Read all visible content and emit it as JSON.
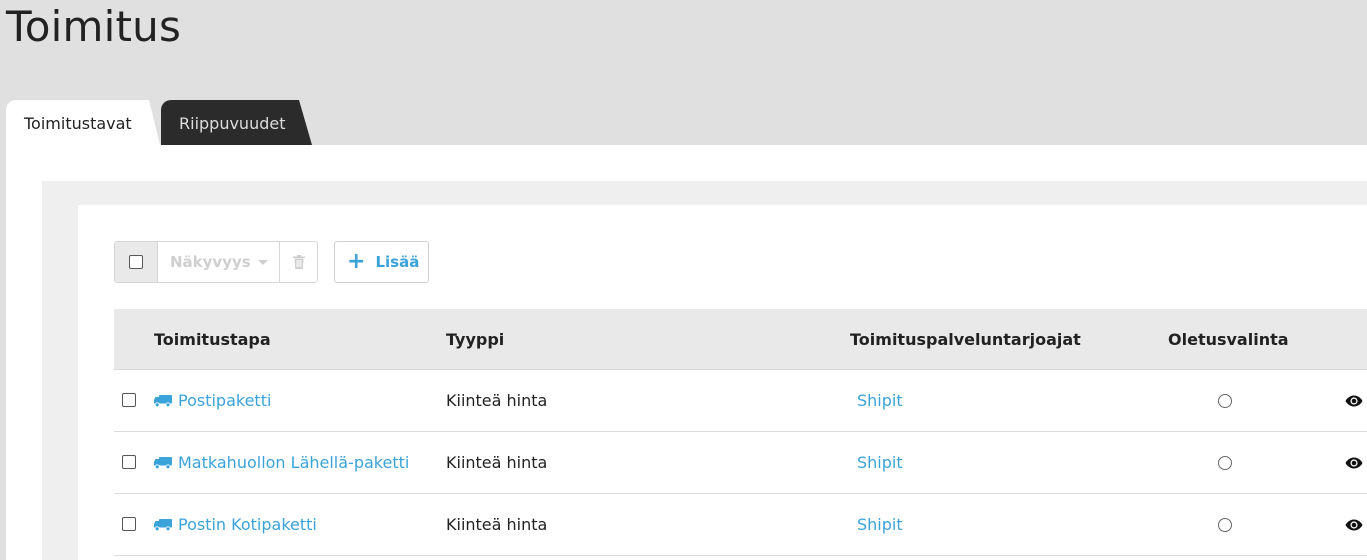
{
  "page": {
    "title": "Toimitus"
  },
  "tabs": [
    {
      "label": "Toimitustavat",
      "active": true
    },
    {
      "label": "Riippuvuudet",
      "active": false
    }
  ],
  "toolbar": {
    "visibility_label": "Näkyvyys",
    "add_label": "Lisää",
    "icons": {
      "trash": "trash-icon",
      "add": "plus-icon",
      "caret": "caret-down-icon"
    }
  },
  "table": {
    "columns": [
      "Toimitustapa",
      "Tyyppi",
      "Toimituspalveluntarjoajat",
      "Oletusvalinta"
    ],
    "rows": [
      {
        "name": "Postipaketti",
        "type": "Kiinteä hinta",
        "provider": "Shipit"
      },
      {
        "name": "Matkahuollon Lähellä-paketti",
        "type": "Kiinteä hinta",
        "provider": "Shipit"
      },
      {
        "name": "Postin Kotipaketti",
        "type": "Kiinteä hinta",
        "provider": "Shipit"
      }
    ]
  },
  "colors": {
    "accent": "#3aa3d9",
    "tab_dark": "#2b2b2b",
    "background": "#e0e0e0"
  }
}
